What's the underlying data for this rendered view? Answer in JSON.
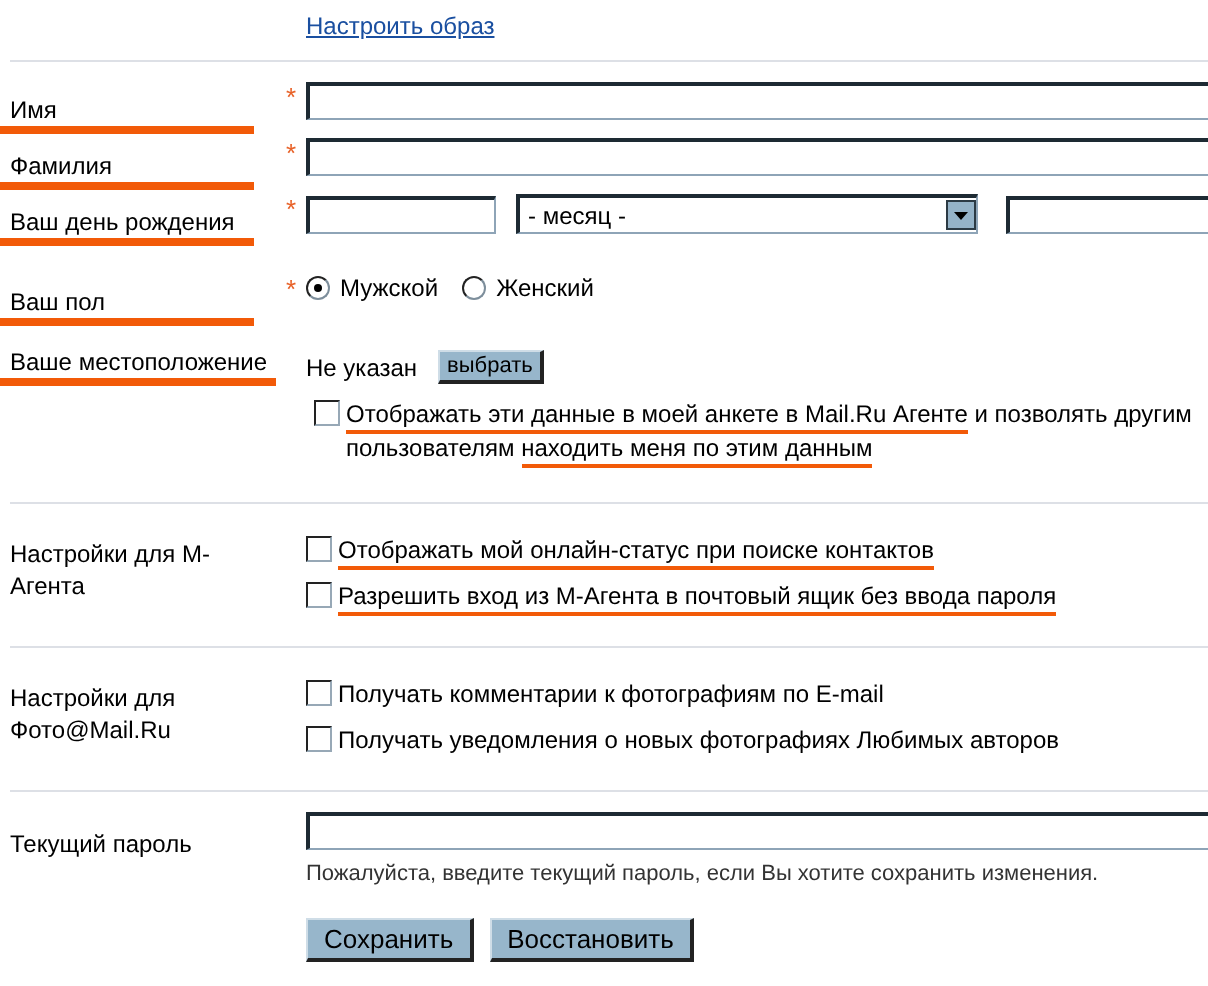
{
  "top_link": "Настроить образ",
  "required_mark": "*",
  "personal": {
    "rows": [
      {
        "kind": "text",
        "label": "Имя",
        "required": true,
        "highlighted": true
      },
      {
        "kind": "text",
        "label": "Фамилия",
        "required": true,
        "highlighted": true
      },
      {
        "kind": "birthday",
        "label": "Ваш день рождения",
        "required": true,
        "highlighted": true,
        "month": "- месяц -"
      },
      {
        "kind": "gender",
        "label": "Ваш пол",
        "required": true,
        "highlighted": true,
        "options": [
          {
            "label": "Мужской",
            "selected": true
          },
          {
            "label": "Женский",
            "selected": false
          }
        ]
      },
      {
        "kind": "location",
        "label": "Ваше местоположение",
        "required": false,
        "highlighted": true,
        "value": "Не указан",
        "button": "выбрать"
      }
    ],
    "checkboxes": [
      {
        "checked": false,
        "parts": [
          {
            "text": "Отображать эти данные в моей анкете в Mail.Ru Агенте",
            "marked": true
          },
          {
            "text": " и позволять другим пользователям ",
            "marked": false
          },
          {
            "text": "находить меня по этим данным",
            "marked": true
          }
        ]
      }
    ]
  },
  "sections": [
    {
      "title": "Настройки для М-Агента",
      "checkboxes": [
        {
          "checked": false,
          "parts": [
            {
              "text": "Отображать мой онлайн-статус при поиске контактов",
              "marked": true
            }
          ]
        },
        {
          "checked": false,
          "parts": [
            {
              "text": "Разрешить вход из М-Агента в почтовый ящик без ввода пароля",
              "marked": true
            }
          ]
        }
      ]
    },
    {
      "title": "Настройки для Фото@Mail.Ru",
      "checkboxes": [
        {
          "checked": false,
          "parts": [
            {
              "text": "Получать комментарии к фотографиям по E-mail",
              "marked": false
            }
          ]
        },
        {
          "checked": false,
          "parts": [
            {
              "text": "Получать уведомления о новых фотографиях Любимых авторов",
              "marked": false
            }
          ]
        }
      ]
    }
  ],
  "password": {
    "label": "Текущий пароль",
    "hint": "Пожалуйста, введите текущий пароль, если Вы хотите сохранить изменения."
  },
  "buttons": [
    "Сохранить",
    "Восстановить"
  ]
}
